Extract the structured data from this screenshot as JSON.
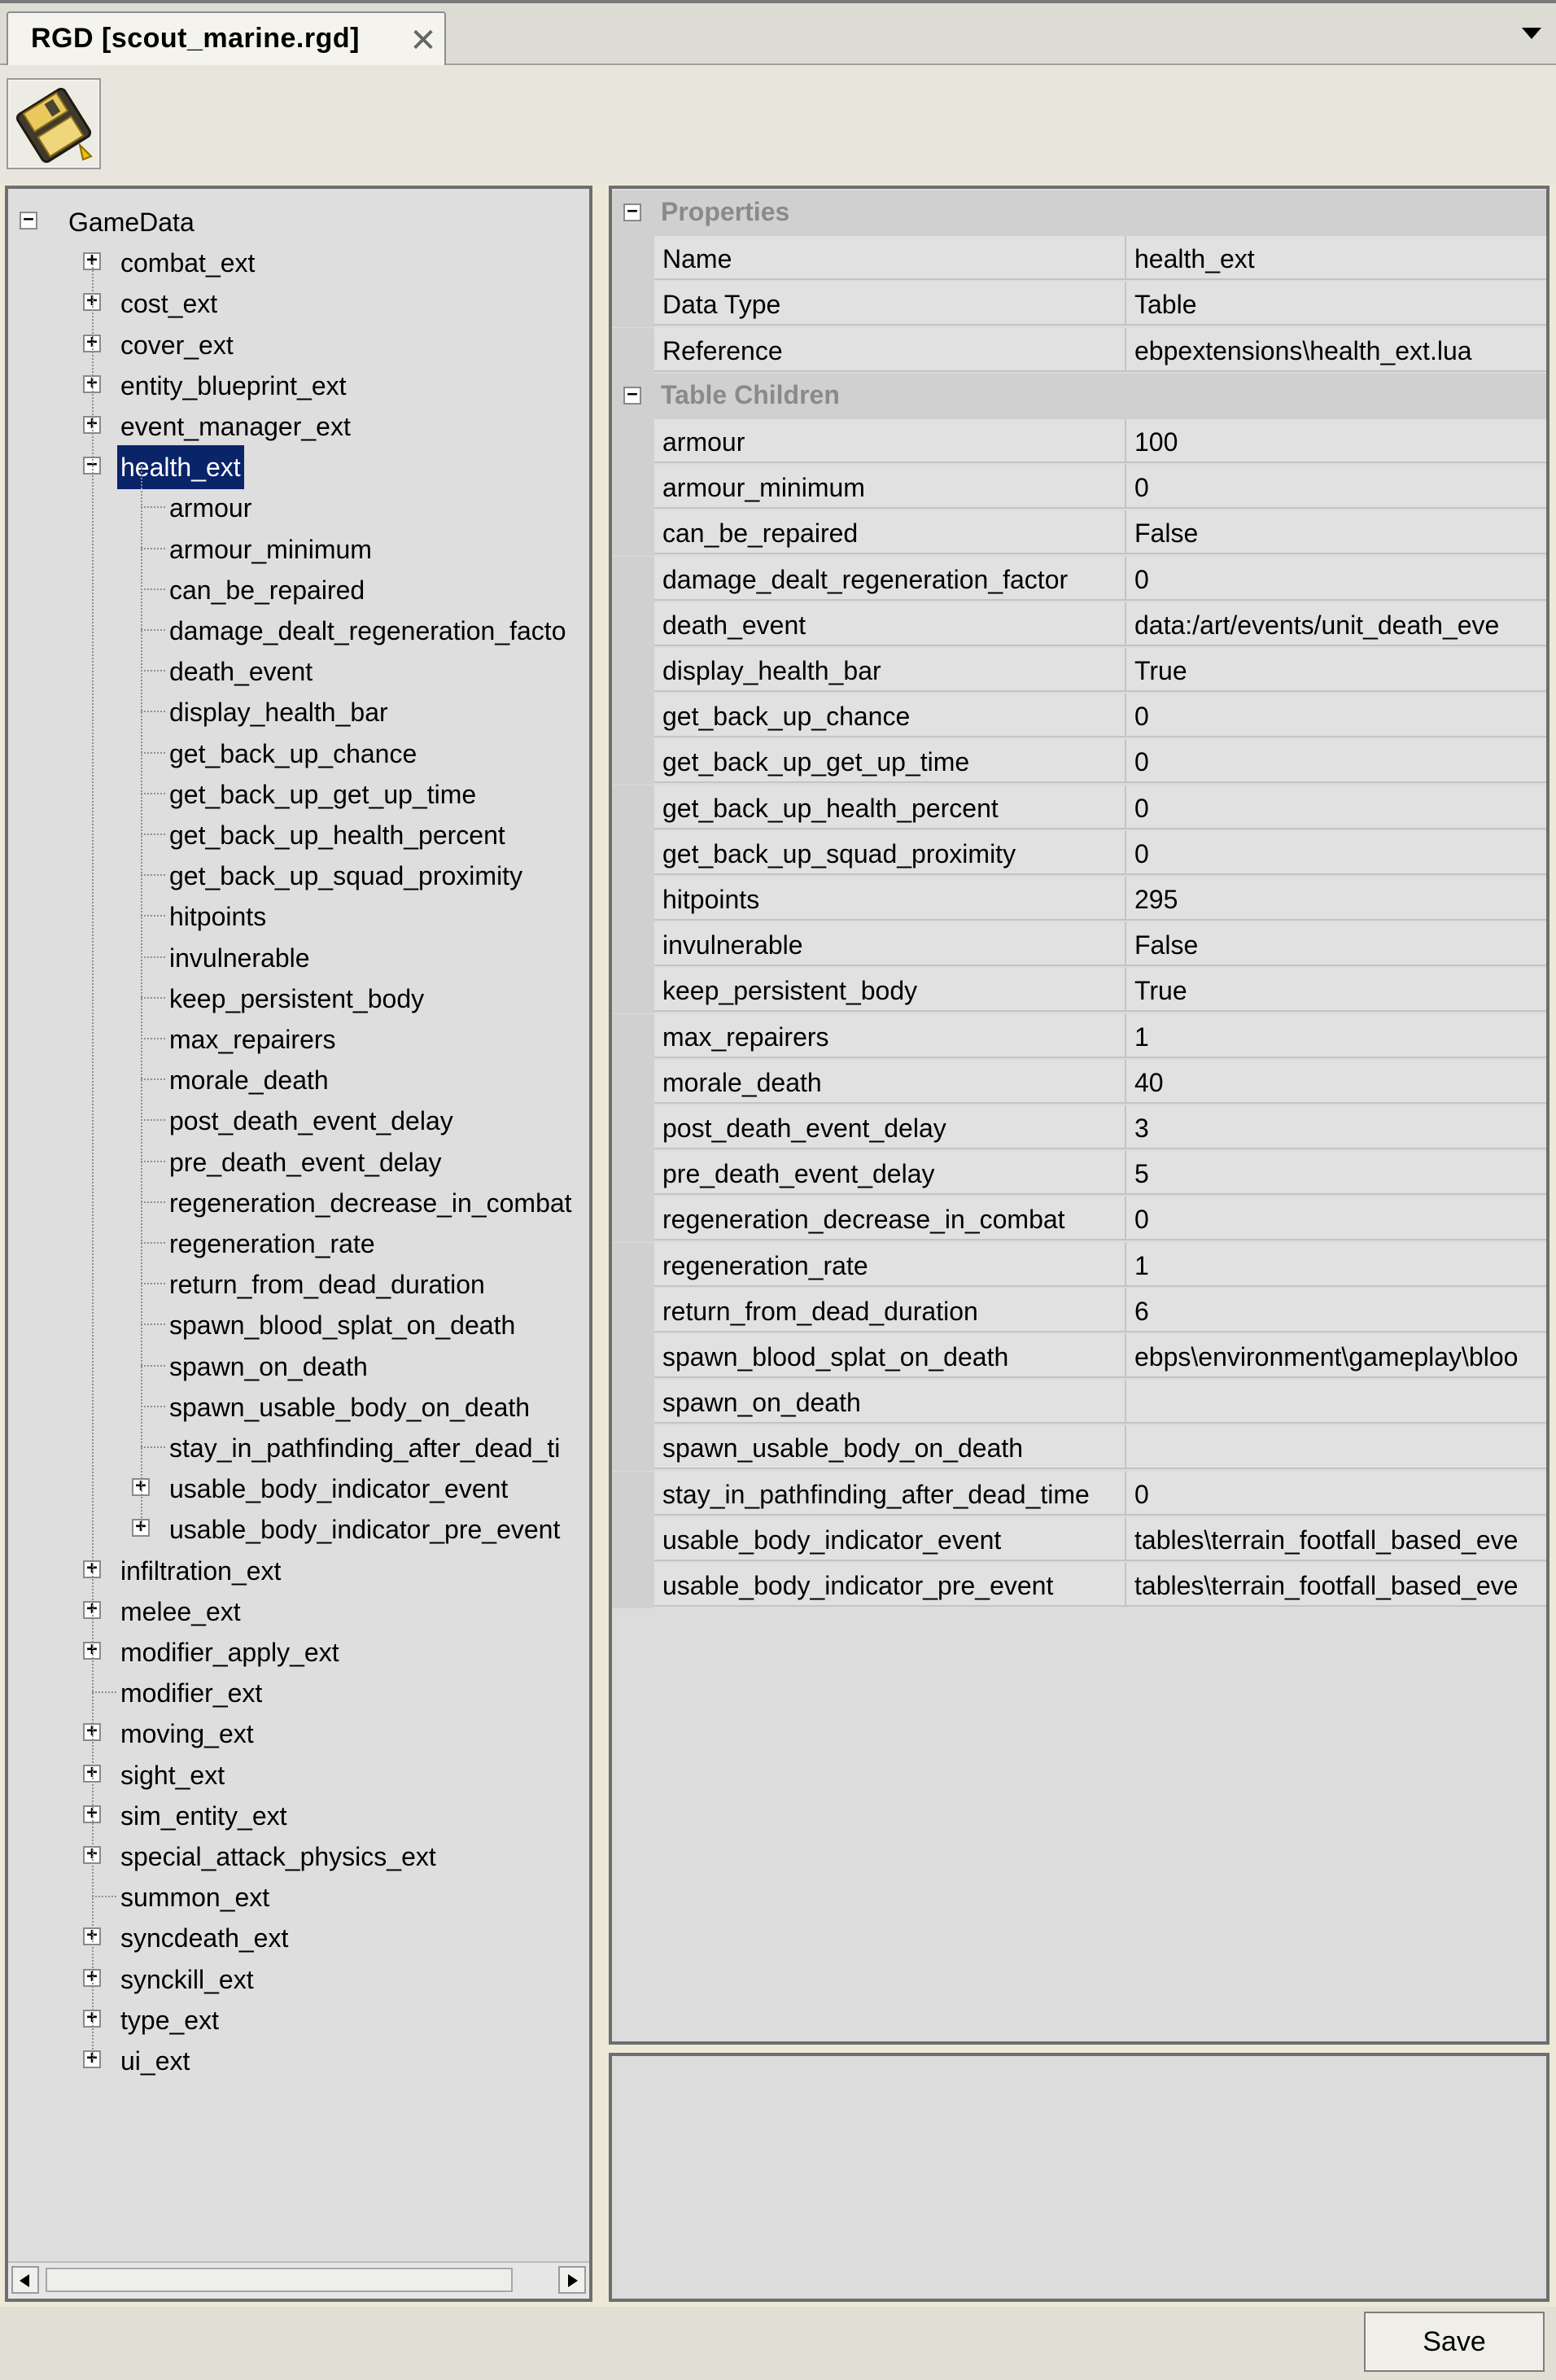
{
  "tab": {
    "title": "RGD [scout_marine.rgd]",
    "close_glyph": "✕"
  },
  "toolbar": {
    "save_icon": "floppy-disk-icon"
  },
  "tree": {
    "root": "GameData",
    "nodes": [
      {
        "label": "combat_ext",
        "level": 1,
        "expander": "+"
      },
      {
        "label": "cost_ext",
        "level": 1,
        "expander": "+"
      },
      {
        "label": "cover_ext",
        "level": 1,
        "expander": "+"
      },
      {
        "label": "entity_blueprint_ext",
        "level": 1,
        "expander": "+"
      },
      {
        "label": "event_manager_ext",
        "level": 1,
        "expander": "+"
      },
      {
        "label": "health_ext",
        "level": 1,
        "expander": "-",
        "selected": true
      },
      {
        "label": "armour",
        "level": 2
      },
      {
        "label": "armour_minimum",
        "level": 2
      },
      {
        "label": "can_be_repaired",
        "level": 2
      },
      {
        "label": "damage_dealt_regeneration_facto",
        "level": 2
      },
      {
        "label": "death_event",
        "level": 2
      },
      {
        "label": "display_health_bar",
        "level": 2
      },
      {
        "label": "get_back_up_chance",
        "level": 2
      },
      {
        "label": "get_back_up_get_up_time",
        "level": 2
      },
      {
        "label": "get_back_up_health_percent",
        "level": 2
      },
      {
        "label": "get_back_up_squad_proximity",
        "level": 2
      },
      {
        "label": "hitpoints",
        "level": 2
      },
      {
        "label": "invulnerable",
        "level": 2
      },
      {
        "label": "keep_persistent_body",
        "level": 2
      },
      {
        "label": "max_repairers",
        "level": 2
      },
      {
        "label": "morale_death",
        "level": 2
      },
      {
        "label": "post_death_event_delay",
        "level": 2
      },
      {
        "label": "pre_death_event_delay",
        "level": 2
      },
      {
        "label": "regeneration_decrease_in_combat",
        "level": 2
      },
      {
        "label": "regeneration_rate",
        "level": 2
      },
      {
        "label": "return_from_dead_duration",
        "level": 2
      },
      {
        "label": "spawn_blood_splat_on_death",
        "level": 2
      },
      {
        "label": "spawn_on_death",
        "level": 2
      },
      {
        "label": "spawn_usable_body_on_death",
        "level": 2
      },
      {
        "label": "stay_in_pathfinding_after_dead_ti",
        "level": 2
      },
      {
        "label": "usable_body_indicator_event",
        "level": 2,
        "expander": "+"
      },
      {
        "label": "usable_body_indicator_pre_event",
        "level": 2,
        "expander": "+"
      },
      {
        "label": "infiltration_ext",
        "level": 1,
        "expander": "+"
      },
      {
        "label": "melee_ext",
        "level": 1,
        "expander": "+"
      },
      {
        "label": "modifier_apply_ext",
        "level": 1,
        "expander": "+"
      },
      {
        "label": "modifier_ext",
        "level": 1
      },
      {
        "label": "moving_ext",
        "level": 1,
        "expander": "+"
      },
      {
        "label": "sight_ext",
        "level": 1,
        "expander": "+"
      },
      {
        "label": "sim_entity_ext",
        "level": 1,
        "expander": "+"
      },
      {
        "label": "special_attack_physics_ext",
        "level": 1,
        "expander": "+"
      },
      {
        "label": "summon_ext",
        "level": 1
      },
      {
        "label": "syncdeath_ext",
        "level": 1,
        "expander": "+"
      },
      {
        "label": "synckill_ext",
        "level": 1,
        "expander": "+"
      },
      {
        "label": "type_ext",
        "level": 1,
        "expander": "+"
      },
      {
        "label": "ui_ext",
        "level": 1,
        "expander": "+"
      }
    ]
  },
  "properties": {
    "category_label": "Properties",
    "rows": [
      {
        "name": "Name",
        "value": "health_ext"
      },
      {
        "name": "Data Type",
        "value": "Table"
      },
      {
        "name": "Reference",
        "value": "ebpextensions\\health_ext.lua"
      }
    ]
  },
  "table_children": {
    "category_label": "Table Children",
    "rows": [
      {
        "name": "armour",
        "value": "100"
      },
      {
        "name": "armour_minimum",
        "value": "0"
      },
      {
        "name": "can_be_repaired",
        "value": "False"
      },
      {
        "name": "damage_dealt_regeneration_factor",
        "value": "0"
      },
      {
        "name": "death_event",
        "value": "data:/art/events/unit_death_eve"
      },
      {
        "name": "display_health_bar",
        "value": "True"
      },
      {
        "name": "get_back_up_chance",
        "value": "0"
      },
      {
        "name": "get_back_up_get_up_time",
        "value": "0"
      },
      {
        "name": "get_back_up_health_percent",
        "value": "0"
      },
      {
        "name": "get_back_up_squad_proximity",
        "value": "0"
      },
      {
        "name": "hitpoints",
        "value": "295"
      },
      {
        "name": "invulnerable",
        "value": "False"
      },
      {
        "name": "keep_persistent_body",
        "value": "True"
      },
      {
        "name": "max_repairers",
        "value": "1"
      },
      {
        "name": "morale_death",
        "value": "40"
      },
      {
        "name": "post_death_event_delay",
        "value": "3"
      },
      {
        "name": "pre_death_event_delay",
        "value": "5"
      },
      {
        "name": "regeneration_decrease_in_combat",
        "value": "0"
      },
      {
        "name": "regeneration_rate",
        "value": "1"
      },
      {
        "name": "return_from_dead_duration",
        "value": "6"
      },
      {
        "name": "spawn_blood_splat_on_death",
        "value": "ebps\\environment\\gameplay\\bloo"
      },
      {
        "name": "spawn_on_death",
        "value": ""
      },
      {
        "name": "spawn_usable_body_on_death",
        "value": ""
      },
      {
        "name": "stay_in_pathfinding_after_dead_time",
        "value": "0"
      },
      {
        "name": "usable_body_indicator_event",
        "value": "tables\\terrain_footfall_based_eve"
      },
      {
        "name": "usable_body_indicator_pre_event",
        "value": "tables\\terrain_footfall_based_eve"
      }
    ]
  },
  "footer": {
    "save_label": "Save"
  },
  "colors": {
    "selection": "#0a246a",
    "panel": "#dcdcdc",
    "window": "#ece9d8"
  }
}
